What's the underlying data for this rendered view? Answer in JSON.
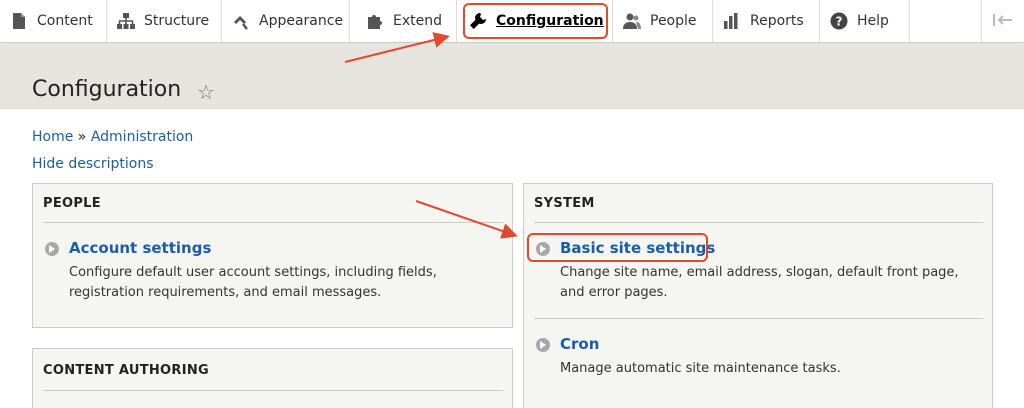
{
  "toolbar": {
    "tabs": [
      {
        "label": "Content",
        "icon": "content-icon"
      },
      {
        "label": "Structure",
        "icon": "structure-icon"
      },
      {
        "label": "Appearance",
        "icon": "appearance-icon"
      },
      {
        "label": "Extend",
        "icon": "extend-icon"
      },
      {
        "label": "Configuration",
        "icon": "wrench-icon"
      },
      {
        "label": "People",
        "icon": "people-icon"
      },
      {
        "label": "Reports",
        "icon": "reports-icon"
      },
      {
        "label": "Help",
        "icon": "help-icon"
      }
    ],
    "active_tab": "Configuration"
  },
  "page": {
    "title": "Configuration"
  },
  "breadcrumb": {
    "home": "Home",
    "separator": "»",
    "admin": "Administration"
  },
  "hide_descriptions": "Hide descriptions",
  "panels": {
    "people": {
      "title": "PEOPLE",
      "items": [
        {
          "link": "Account settings",
          "desc_line1": "Configure default user account settings, including fields,",
          "desc_line2": "registration requirements, and email messages."
        }
      ]
    },
    "content_authoring": {
      "title": "CONTENT AUTHORING"
    },
    "system": {
      "title": "SYSTEM",
      "items": [
        {
          "link": "Basic site settings",
          "desc_line1": "Change site name, email address, slogan, default front page,",
          "desc_line2": "and error pages."
        },
        {
          "link": "Cron",
          "desc_line1": "Manage automatic site maintenance tasks."
        }
      ]
    }
  },
  "colors": {
    "link": "#1b5ea5",
    "annotation": "#e04a2f",
    "header_band": "#e6e4df"
  }
}
